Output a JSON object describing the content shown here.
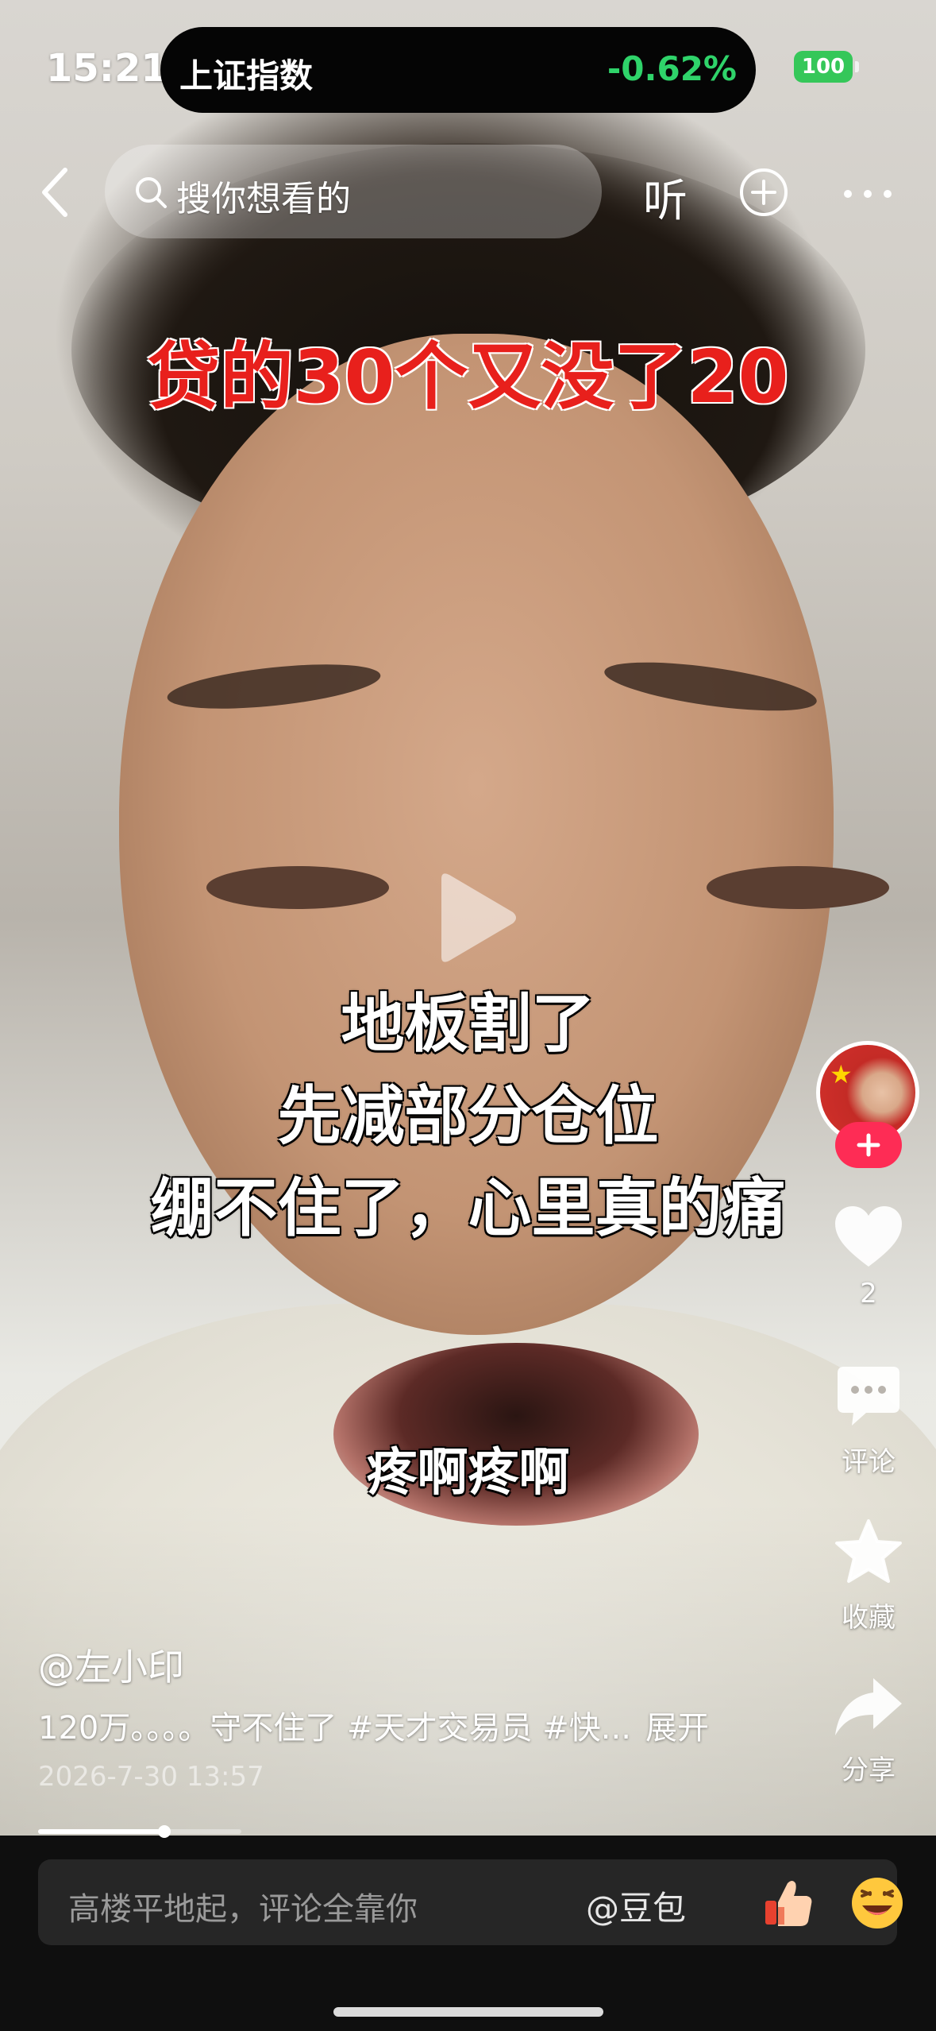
{
  "status_bar": {
    "time": "15:21",
    "live_activity": {
      "name": "上证指数",
      "change": "-0.62%",
      "change_color": "#2fd36a"
    },
    "battery": "100"
  },
  "nav": {
    "back_icon": "chevron-left-icon",
    "search_placeholder": "搜你想看的",
    "listen_label": "听",
    "add_icon": "plus-circle-icon",
    "more_icon": "more-dots-icon"
  },
  "video": {
    "headline": "贷的30个又没了20",
    "headline_color": "#e8201c",
    "captions": [
      "地板割了",
      "先减部分仓位",
      "绷不住了，心里真的痛",
      "疼啊疼啊"
    ]
  },
  "actions": {
    "like_count": "2",
    "comment_label": "评论",
    "favorite_label": "收藏",
    "share_label": "分享",
    "follow_color": "#fe2c55"
  },
  "post": {
    "author": "@左小印",
    "description": "120万。。。。守不住了 #天才交易员 #快...",
    "expand_label": "展开",
    "date": "2026-7-30 13:57",
    "progress": 0.62
  },
  "comment_bar": {
    "placeholder": "高楼平地起，评论全靠你",
    "mention": "@豆包"
  }
}
